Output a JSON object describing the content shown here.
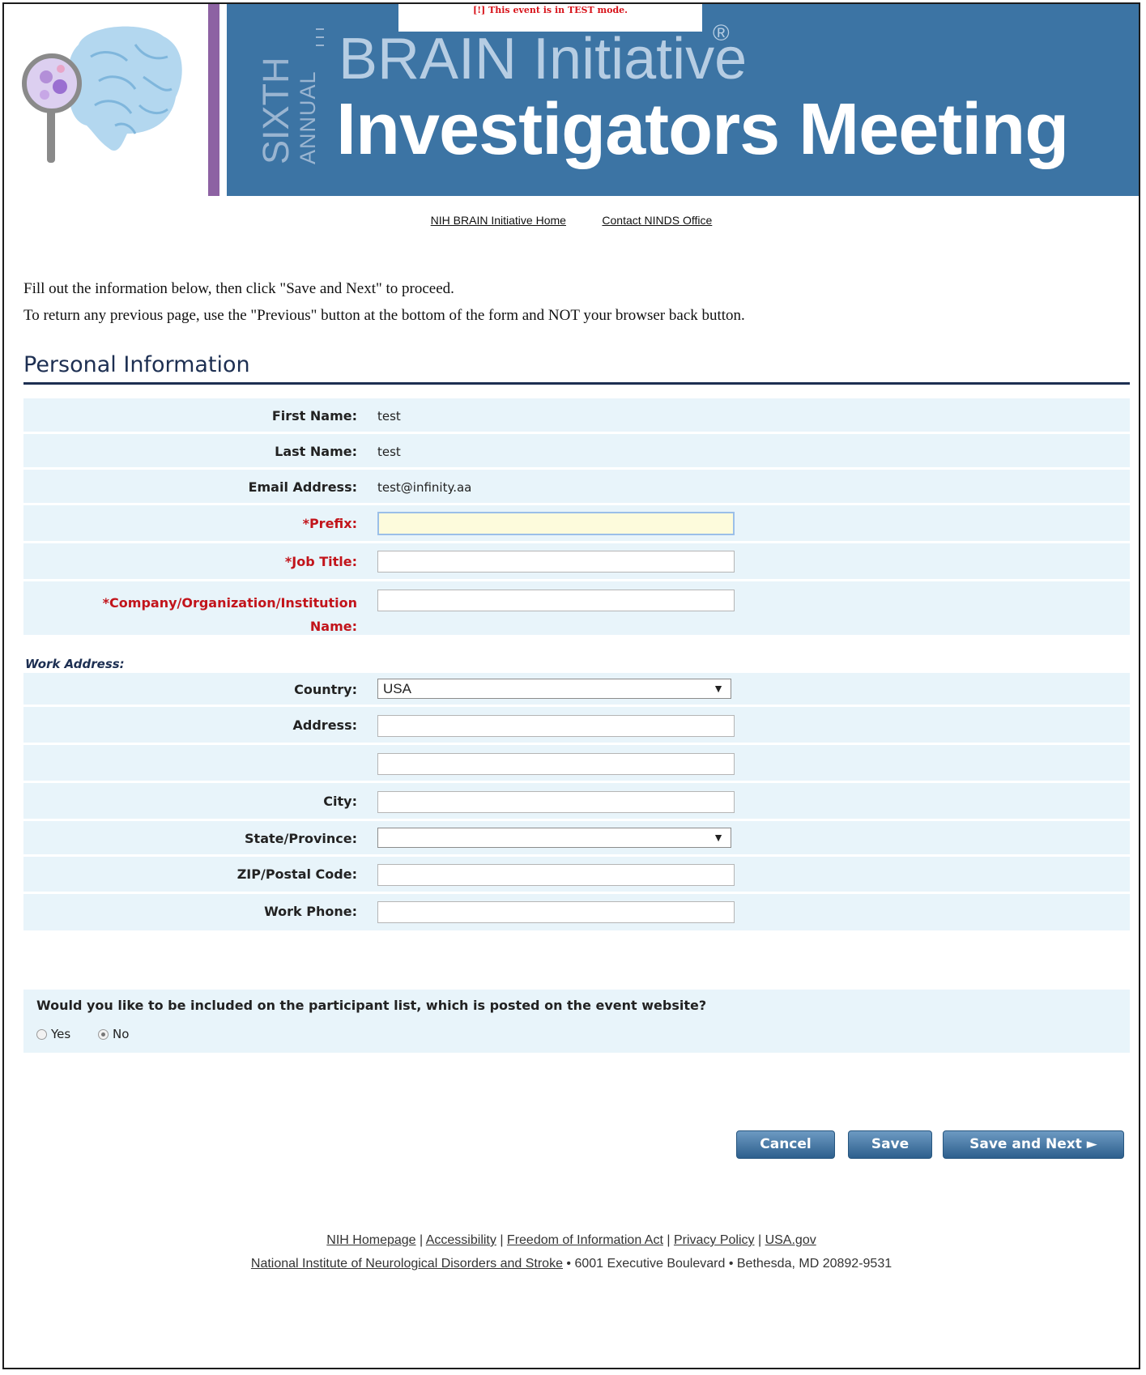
{
  "banner": {
    "test_mode": "[!] This event is in TEST mode.",
    "ordinal": "SIXTH",
    "annual": "ANNUAL",
    "title_line1": "BRAIN Initiative",
    "registered": "®",
    "title_line2": "Investigators Meeting",
    "colors": {
      "blue": "#3c74a4",
      "purple": "#8d62a3"
    }
  },
  "nav": {
    "home": "NIH BRAIN Initiative Home",
    "contact": "Contact NINDS Office"
  },
  "intro": {
    "line1": "Fill out the information below, then click \"Save and Next\" to proceed.",
    "line2": "To return any previous page, use the \"Previous\" button at the bottom of the form and NOT your browser back button."
  },
  "section_title": "Personal Information",
  "personal": {
    "first_name_label": "First Name:",
    "first_name": "test",
    "last_name_label": "Last Name:",
    "last_name": "test",
    "email_label": "Email Address:",
    "email": "test@infinity.aa",
    "prefix_label": "*Prefix:",
    "prefix": "",
    "job_title_label": "*Job Title:",
    "job_title": "",
    "company_label_1": "*Company/Organization/Institution",
    "company_label_2": "Name:",
    "company": ""
  },
  "work_address": {
    "heading": "Work Address:",
    "country_label": "Country:",
    "country": "USA",
    "address_label": "Address:",
    "address1": "",
    "address2": "",
    "city_label": "City:",
    "city": "",
    "state_label": "State/Province:",
    "state": "",
    "zip_label": "ZIP/Postal Code:",
    "zip": "",
    "phone_label": "Work Phone:",
    "phone": ""
  },
  "participant": {
    "question": "Would you like to be included on the participant list, which is posted on the event website?",
    "yes": "Yes",
    "no": "No",
    "selected": "No"
  },
  "buttons": {
    "cancel": "Cancel",
    "save": "Save",
    "save_next": "Save and Next ►"
  },
  "footer": {
    "nih_home": "NIH Homepage",
    "accessibility": "Accessibility",
    "foia": "Freedom of Information Act",
    "privacy": "Privacy Policy",
    "usagov": "USA.gov",
    "sep": " | ",
    "ninds": "National Institute of Neurological Disorders and Stroke",
    "address": " • 6001 Executive Boulevard • Bethesda, MD 20892-9531"
  }
}
